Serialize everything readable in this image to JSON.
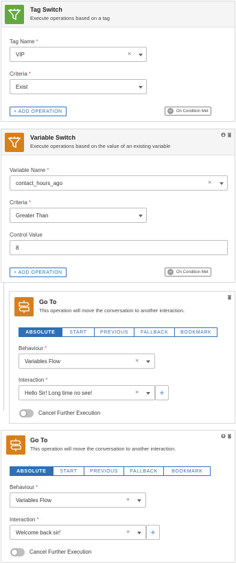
{
  "tag_switch": {
    "title": "Tag Switch",
    "subtitle": "Execute operations based on a tag",
    "icon": "funnel-icon",
    "tag_name": {
      "label": "Tag Name",
      "required": "*",
      "value": "VIP"
    },
    "criteria": {
      "label": "Criteria",
      "required": "*",
      "value": "Exist"
    },
    "add_operation": "+ ADD OPERATION",
    "condition_button": "On Condition Met"
  },
  "variable_switch": {
    "title": "Variable Switch",
    "subtitle": "Execute operations based on the value of an existing variable",
    "icon": "funnel-icon",
    "variable_name": {
      "label": "Variable Name",
      "required": "*",
      "value": "contact_hours_ago"
    },
    "criteria": {
      "label": "Criteria",
      "required": "*",
      "value": "Greater Than"
    },
    "control_value": {
      "label": "Control Value",
      "value": "8"
    },
    "add_operation": "+ ADD OPERATION",
    "condition_button": "On Condition Met"
  },
  "goto_nested": {
    "title": "Go To",
    "subtitle": "This operation will move the conversation to another interaction.",
    "icon": "signpost-icon",
    "tabs": [
      "ABSOLUTE",
      "START",
      "PREVIOUS",
      "FALLBACK",
      "BOOKMARK"
    ],
    "active_tab": "ABSOLUTE",
    "behaviour": {
      "label": "Behaviour",
      "required": "*",
      "value": "Variables Flow"
    },
    "interaction": {
      "label": "Interaction",
      "required": "*",
      "value": "Hello Sir! Long time no see!"
    },
    "cancel_label": "Cancel Further Execution",
    "cancel_enabled": false
  },
  "goto_bottom": {
    "title": "Go To",
    "subtitle": "This operation will move the conversation to another interaction.",
    "icon": "signpost-icon",
    "tabs": [
      "ABSOLUTE",
      "START",
      "PREVIOUS",
      "FALLBACK",
      "BOOKMARK"
    ],
    "active_tab": "ABSOLUTE",
    "behaviour": {
      "label": "Behaviour",
      "required": "*",
      "value": "Variables Flow"
    },
    "interaction": {
      "label": "Interaction",
      "required": "*",
      "value": "Welcome back sir!"
    },
    "cancel_label": "Cancel Further Execution",
    "cancel_enabled": false
  },
  "colors": {
    "accent": "#2f6fb5",
    "tag_icon_bg": "#62a83f",
    "goto_icon_bg": "#d87f1a",
    "required": "#e05555"
  }
}
